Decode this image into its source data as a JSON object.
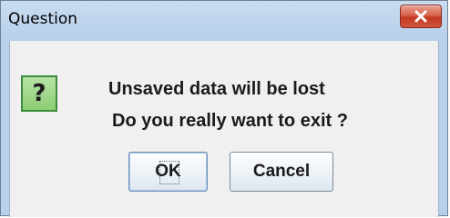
{
  "dialog": {
    "title": "Question",
    "close_icon": "close-x-icon",
    "question_icon": "question-mark-icon",
    "question_glyph": "?",
    "message_line1": "Unsaved data will be lost",
    "message_line2": "Do you really want to exit ?",
    "ok_label": "OK",
    "cancel_label": "Cancel",
    "colors": {
      "title_bar": "#bcd3ec",
      "client_bg": "#f0f0f0",
      "close_button": "#d9624a",
      "question_icon_bg": "#8ccc73"
    }
  }
}
